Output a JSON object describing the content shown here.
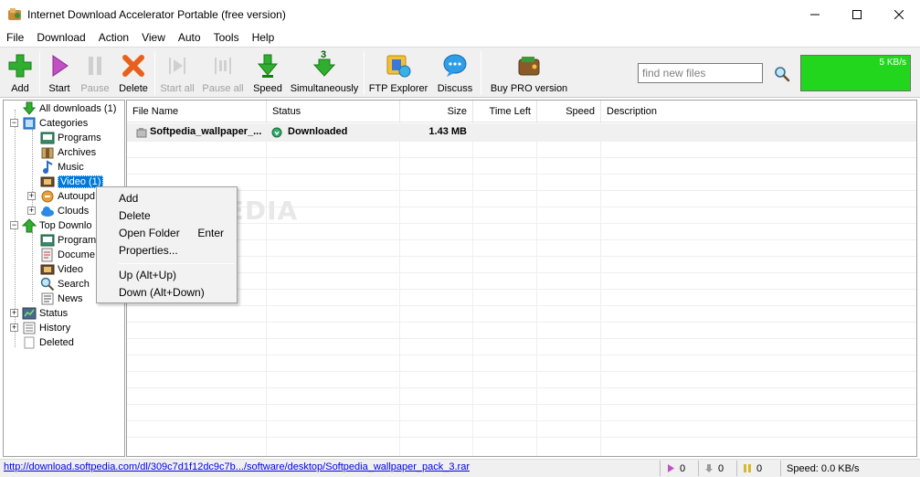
{
  "window": {
    "title": "Internet Download Accelerator Portable (free version)"
  },
  "menu": [
    "File",
    "Download",
    "Action",
    "View",
    "Auto",
    "Tools",
    "Help"
  ],
  "toolbar": {
    "add": "Add",
    "start": "Start",
    "pause": "Pause",
    "delete": "Delete",
    "start_all": "Start all",
    "pause_all": "Pause all",
    "speed": "Speed",
    "simultaneously": "Simultaneously",
    "simultaneously_count": "3",
    "ftp_explorer": "FTP Explorer",
    "discuss": "Discuss",
    "buy_pro": "Buy PRO version",
    "search_placeholder": "find new files",
    "speed_graph_label": "5 KB/s",
    "speed_graph_color": "#22d61e"
  },
  "tree": {
    "all_downloads": "All downloads (1)",
    "categories": "Categories",
    "programs": "Programs",
    "archives": "Archives",
    "music": "Music",
    "video": "Video (1)",
    "autoupdate": "Autoupd",
    "clouds": "Clouds",
    "top_downloads": "Top Downlo",
    "top_programs": "Program",
    "top_documents": "Docume",
    "top_video": "Video",
    "top_search": "Search",
    "top_news": "News",
    "status": "Status",
    "history": "History",
    "deleted": "Deleted"
  },
  "filelist": {
    "columns": {
      "file_name": "File Name",
      "status": "Status",
      "size": "Size",
      "time_left": "Time Left",
      "speed": "Speed",
      "description": "Description"
    },
    "rows": [
      {
        "file_name": "Softpedia_wallpaper_...",
        "status": "Downloaded",
        "size": "1.43 MB",
        "time_left": "",
        "speed": "",
        "description": ""
      }
    ]
  },
  "watermark": "SOFTPEDIA",
  "context_menu": {
    "add": "Add",
    "delete": "Delete",
    "open_folder": "Open Folder",
    "open_folder_shortcut": "Enter",
    "properties": "Properties...",
    "up": "Up (Alt+Up)",
    "down": "Down (Alt+Down)"
  },
  "statusbar": {
    "url": "http://download.softpedia.com/dl/309c7d1f12dc9c7b.../software/desktop/Softpedia_wallpaper_pack_3.rar",
    "active_count": "0",
    "waiting_count": "0",
    "paused_count": "0",
    "speed": "Speed: 0.0 KB/s"
  },
  "colors": {
    "selection": "#0078d7",
    "link": "#0000ee",
    "add_green": "#2fae2f",
    "delete_orange": "#e8601c"
  }
}
